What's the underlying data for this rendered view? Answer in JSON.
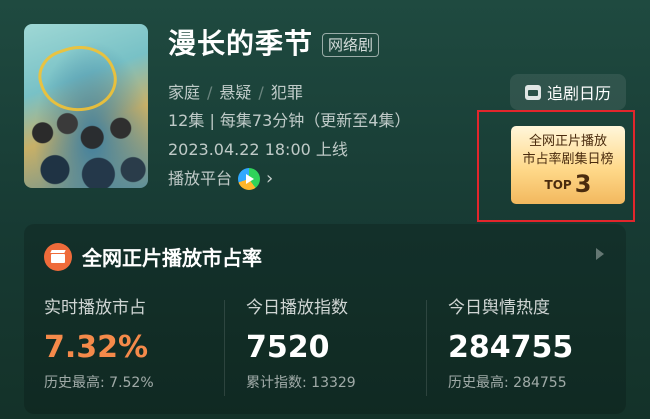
{
  "show": {
    "title": "漫长的季节",
    "type_badge": "网络剧",
    "genres": [
      "家庭",
      "悬疑",
      "犯罪"
    ],
    "episodes": "12集 | 每集73分钟（更新至4集）",
    "release": "2023.04.22 18:00 上线",
    "platform_label": "播放平台"
  },
  "calendar_button": {
    "label": "追剧日历"
  },
  "rank_card": {
    "line1": "全网正片播放",
    "line2": "市占率剧集日榜",
    "top_label": "TOP",
    "top_number": "3"
  },
  "market": {
    "title": "全网正片播放市占率",
    "stats": [
      {
        "label": "实时播放市占",
        "value": "7.32%",
        "sub": "历史最高: 7.52%",
        "highlight_color": "#f58a4a"
      },
      {
        "label": "今日播放指数",
        "value": "7520",
        "sub": "累计指数: 13329"
      },
      {
        "label": "今日舆情热度",
        "value": "284755",
        "sub": "历史最高: 284755"
      }
    ]
  },
  "icons": {
    "calendar": "calendar-icon",
    "play_platform": "play-logo-icon",
    "chevron": "chevron-right-icon",
    "panel": "clapperboard-icon",
    "panel_arrow": "triangle-right-icon"
  },
  "colors": {
    "background": "#1f4a40",
    "accent_orange": "#f58a4a",
    "rank_gold": "#ffd98a",
    "highlight_frame": "#e2262c"
  }
}
